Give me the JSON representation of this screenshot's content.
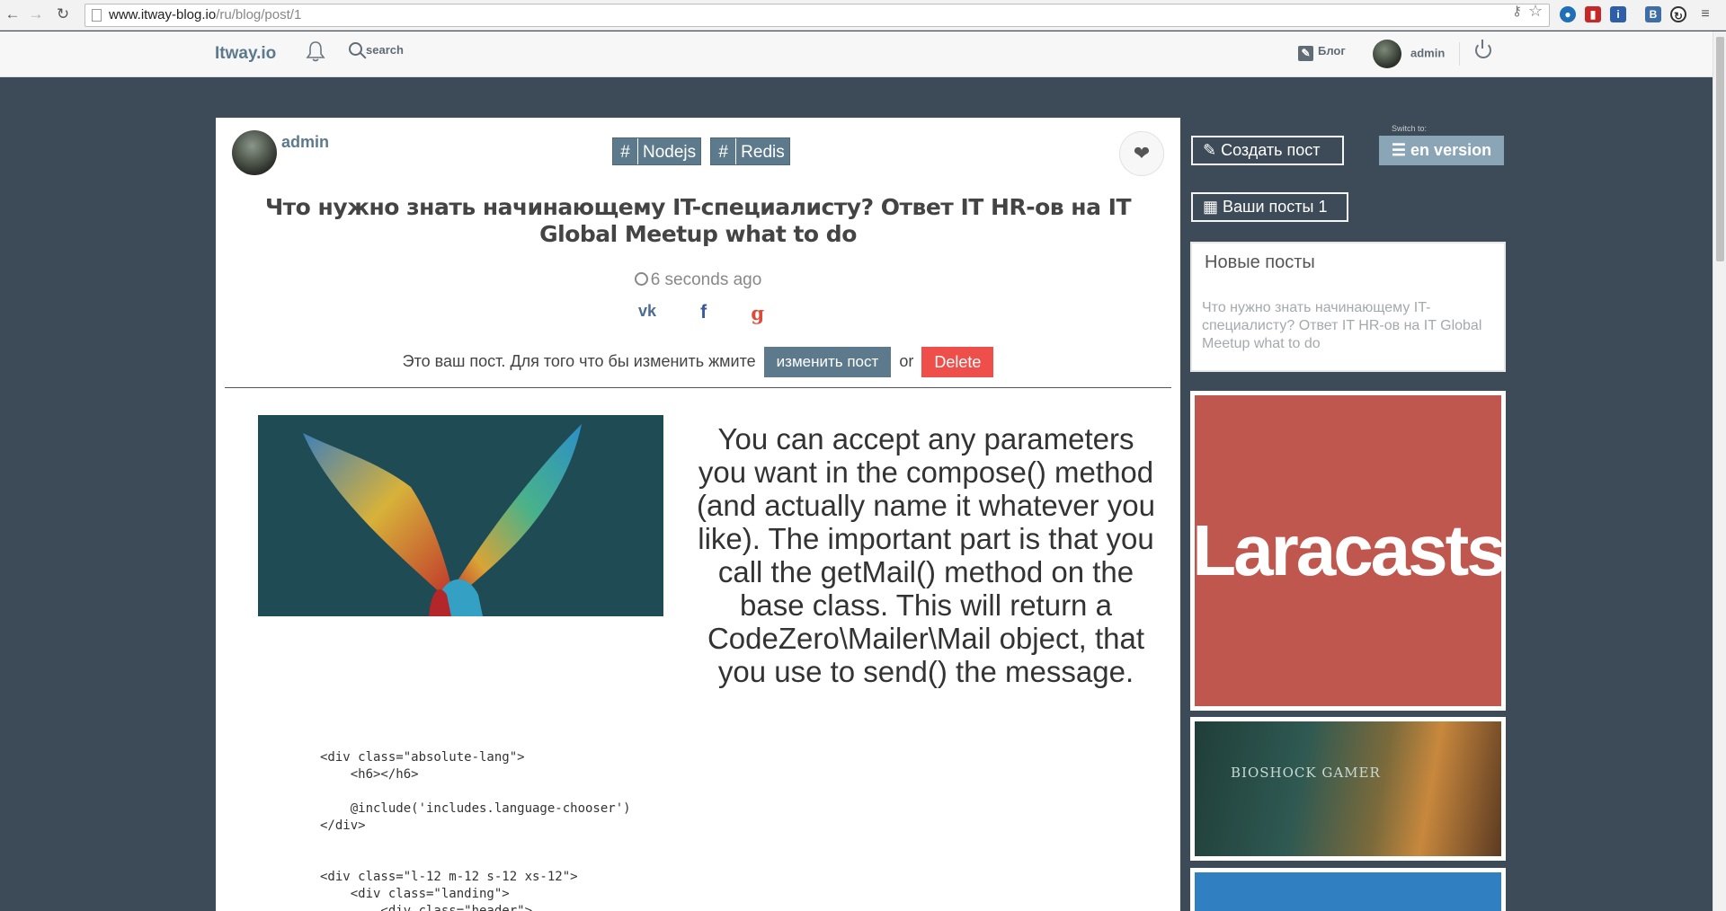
{
  "browser": {
    "url_host": "www.itway-blog.io",
    "url_path": "/ru/blog/post/1"
  },
  "header": {
    "logo": "Itway.io",
    "search_label": "search",
    "blog_label": "Блог",
    "user_name": "admin"
  },
  "post": {
    "author": "admin",
    "tags": [
      "Nodejs",
      "Redis"
    ],
    "title": "Что нужно знать начинающему IT-специалисту? Ответ IT HR-ов на IT Global Meetup what to do",
    "time_ago": "6 seconds ago",
    "social": [
      "vk",
      "f",
      "g"
    ],
    "owner_notice": "Это ваш пост. Для того что бы изменить жмите",
    "edit_label": "изменить пост",
    "or_label": "or",
    "delete_label": "Delete",
    "body": "You can accept any parameters you want in the compose() method (and actually name it whatever you like). The important part is that you call the getMail() method on the base class. This will return a CodeZero\\Mailer\\Mail object, that you use to send() the message.",
    "code": "<div class=\"absolute-lang\">\n    <h6></h6>\n\n    @include('includes.language-chooser')\n</div>\n\n\n<div class=\"l-12 m-12 s-12 xs-12\">\n    <div class=\"landing\">\n        <div class=\"header\">"
  },
  "sidebar": {
    "create_post_label": "Создать пост",
    "switch_to_label": "Switch to:",
    "en_version_label": "en version",
    "my_posts_label": "Ваши посты 1",
    "new_posts_title": "Новые посты",
    "new_posts_link": "Что нужно знать начинающему IT-специалисту? Ответ IT HR-ов на IT Global Meetup what to do",
    "ad1_text": "Laracasts",
    "ad2_text": "BIOSHOCK GAMER"
  },
  "colors": {
    "page_bg": "#3d4a57",
    "accent": "#5d7a8c",
    "delete": "#ee4f4a",
    "laracasts_bg": "#bf574e"
  }
}
